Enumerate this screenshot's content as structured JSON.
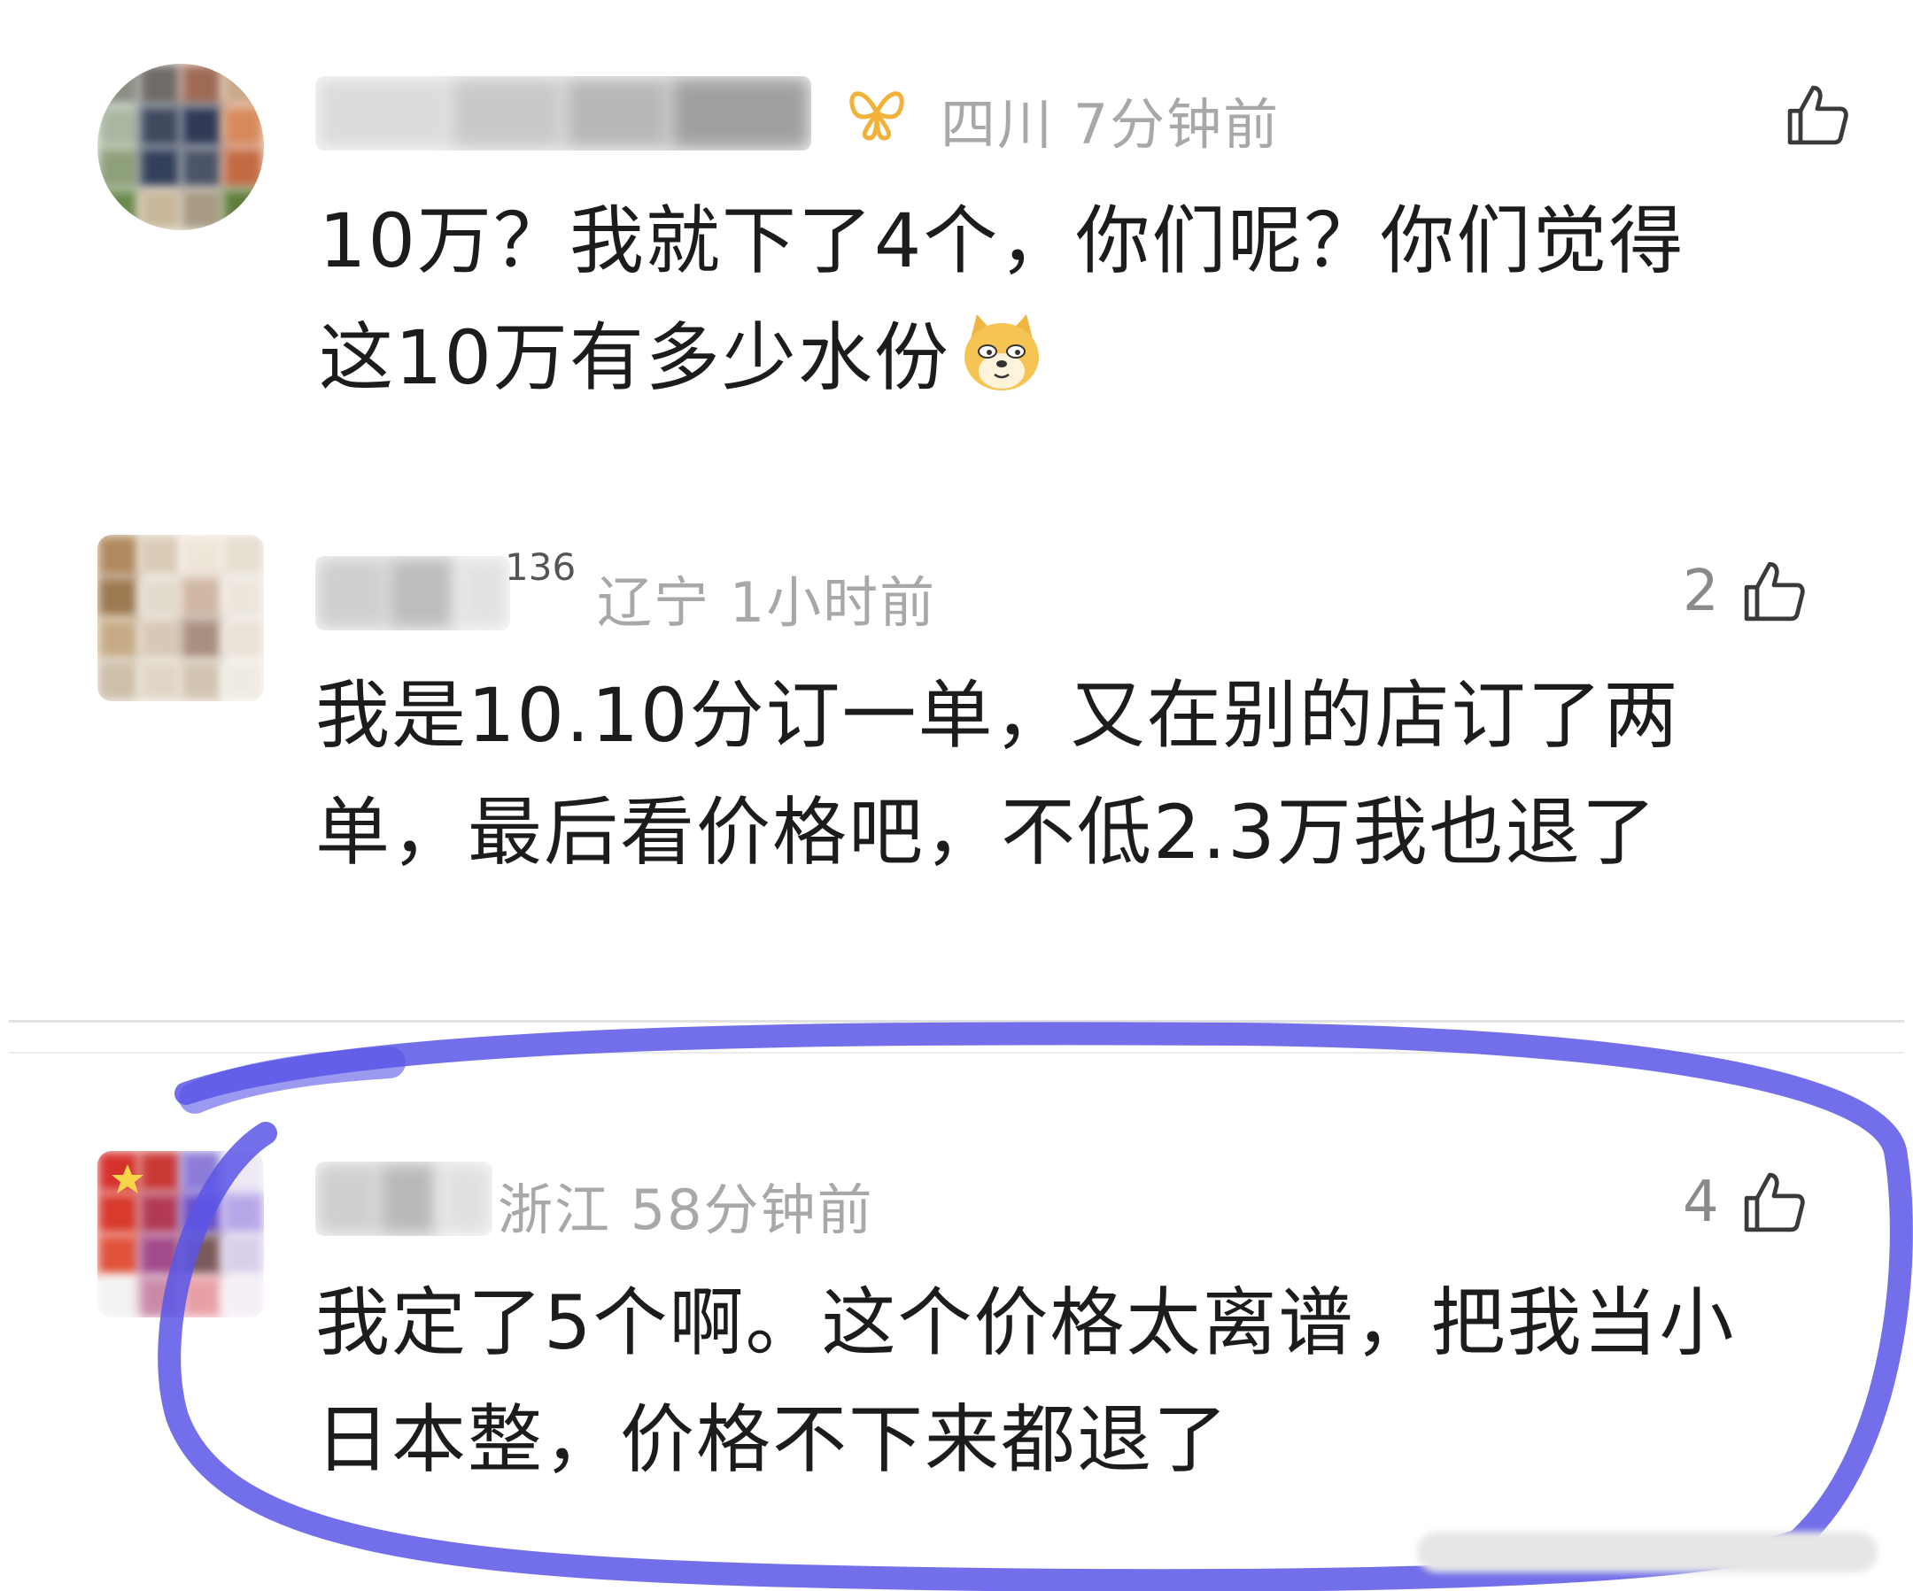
{
  "comments": [
    {
      "location": "四川",
      "time": "7分钟前",
      "likes": "",
      "badge_icon": "butterfly-icon",
      "body_lines": [
        "10万？我就下了4个，你们呢？你们觉得",
        "这10万有多少水份"
      ],
      "emoji": "doge-emoji"
    },
    {
      "name_suffix": "136",
      "location": "辽宁",
      "time": "1小时前",
      "likes": "2",
      "body_lines": [
        "我是10.10分订一单，又在别的店订了两",
        "单，最后看价格吧，不低2.3万我也退了"
      ]
    },
    {
      "location": "浙江",
      "time": "58分钟前",
      "likes": "4",
      "body_lines": [
        "我定了5个啊。这个价格太离谱，把我当小",
        "日本整，价格不下来都退了"
      ]
    }
  ],
  "colors": {
    "text": "#1c1c1c",
    "meta": "#a8a8a8",
    "annotation": "#5a55e6",
    "badge": "#f2b23a"
  }
}
